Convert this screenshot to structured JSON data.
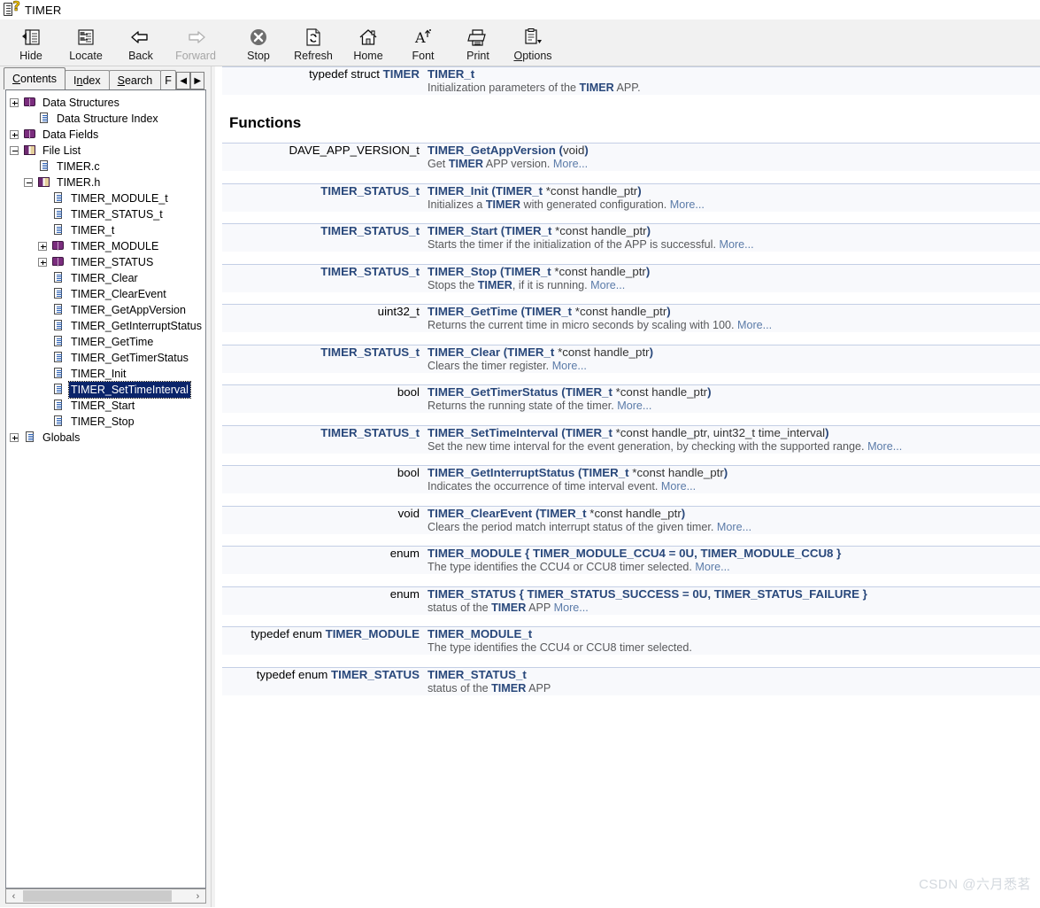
{
  "window": {
    "title": "TIMER",
    "icon": "help-book-question-icon"
  },
  "toolbar": {
    "buttons": [
      {
        "label": "Hide",
        "icon": "hide-pane-icon",
        "disabled": false,
        "accel": ""
      },
      {
        "label": "Locate",
        "icon": "locate-icon",
        "disabled": false,
        "accel": ""
      },
      {
        "label": "Back",
        "icon": "back-arrow-icon",
        "disabled": false,
        "accel": ""
      },
      {
        "label": "Forward",
        "icon": "forward-arrow-icon",
        "disabled": true,
        "accel": ""
      },
      {
        "label": "Stop",
        "icon": "stop-icon",
        "disabled": false,
        "accel": ""
      },
      {
        "label": "Refresh",
        "icon": "refresh-icon",
        "disabled": false,
        "accel": ""
      },
      {
        "label": "Home",
        "icon": "home-icon",
        "disabled": false,
        "accel": ""
      },
      {
        "label": "Font",
        "icon": "font-icon",
        "disabled": false,
        "accel": ""
      },
      {
        "label": "Print",
        "icon": "print-icon",
        "disabled": false,
        "accel": ""
      },
      {
        "label": "Options",
        "icon": "options-icon",
        "disabled": false,
        "accel": "O"
      }
    ]
  },
  "navpane": {
    "tabs": [
      {
        "label": "Contents",
        "active": true
      },
      {
        "label": "Index",
        "active": false
      },
      {
        "label": "Search",
        "active": false
      },
      {
        "label": "F",
        "active": false,
        "clipped": true
      }
    ],
    "spinners": {
      "left": "◀",
      "right": "▶"
    },
    "tree": [
      {
        "label": "Data Structures",
        "icon": "book-icon",
        "expander": "plus",
        "indent": 1,
        "selected": false
      },
      {
        "label": "Data Structure Index",
        "icon": "page-icon",
        "expander": "none",
        "indent": 2,
        "selected": false
      },
      {
        "label": "Data Fields",
        "icon": "book-icon",
        "expander": "plus",
        "indent": 1,
        "selected": false
      },
      {
        "label": "File List",
        "icon": "book-open-icon",
        "expander": "minus",
        "indent": 1,
        "selected": false
      },
      {
        "label": "TIMER.c",
        "icon": "page-icon",
        "expander": "none",
        "indent": 2,
        "selected": false
      },
      {
        "label": "TIMER.h",
        "icon": "book-open-icon",
        "expander": "minus",
        "indent": 2,
        "selected": false
      },
      {
        "label": "TIMER_MODULE_t",
        "icon": "page-icon",
        "expander": "none",
        "indent": 3,
        "selected": false
      },
      {
        "label": "TIMER_STATUS_t",
        "icon": "page-icon",
        "expander": "none",
        "indent": 3,
        "selected": false
      },
      {
        "label": "TIMER_t",
        "icon": "page-icon",
        "expander": "none",
        "indent": 3,
        "selected": false
      },
      {
        "label": "TIMER_MODULE",
        "icon": "book-icon",
        "expander": "plus",
        "indent": 3,
        "selected": false
      },
      {
        "label": "TIMER_STATUS",
        "icon": "book-icon",
        "expander": "plus",
        "indent": 3,
        "selected": false
      },
      {
        "label": "TIMER_Clear",
        "icon": "page-icon",
        "expander": "none",
        "indent": 3,
        "selected": false
      },
      {
        "label": "TIMER_ClearEvent",
        "icon": "page-icon",
        "expander": "none",
        "indent": 3,
        "selected": false
      },
      {
        "label": "TIMER_GetAppVersion",
        "icon": "page-icon",
        "expander": "none",
        "indent": 3,
        "selected": false
      },
      {
        "label": "TIMER_GetInterruptStatus",
        "icon": "page-icon",
        "expander": "none",
        "indent": 3,
        "selected": false
      },
      {
        "label": "TIMER_GetTime",
        "icon": "page-icon",
        "expander": "none",
        "indent": 3,
        "selected": false
      },
      {
        "label": "TIMER_GetTimerStatus",
        "icon": "page-icon",
        "expander": "none",
        "indent": 3,
        "selected": false
      },
      {
        "label": "TIMER_Init",
        "icon": "page-icon",
        "expander": "none",
        "indent": 3,
        "selected": false
      },
      {
        "label": "TIMER_SetTimeInterval",
        "icon": "page-icon",
        "expander": "none",
        "indent": 3,
        "selected": true
      },
      {
        "label": "TIMER_Start",
        "icon": "page-icon",
        "expander": "none",
        "indent": 3,
        "selected": false
      },
      {
        "label": "TIMER_Stop",
        "icon": "page-icon",
        "expander": "none",
        "indent": 3,
        "selected": false
      },
      {
        "label": "Globals",
        "icon": "page-icon",
        "expander": "plus",
        "indent": 1,
        "selected": false
      }
    ],
    "hscroll": {
      "left_arrow": "‹",
      "right_arrow": "›"
    }
  },
  "content": {
    "section_heading": "Functions",
    "rows": [
      {
        "left_plain": "typedef struct ",
        "left_link": "TIMER",
        "name": "TIMER_t",
        "args": "",
        "desc_html": "Initialization parameters of the <b>TIMER</b> APP.",
        "more": ""
      },
      {
        "left_plain": "DAVE_APP_VERSION_t",
        "left_link": "",
        "name": "TIMER_GetAppVersion",
        "args": " (void)",
        "desc_html": "Get <b>TIMER</b> APP version. ",
        "more": "More..."
      },
      {
        "left_plain": "",
        "left_link": "TIMER_STATUS_t",
        "name": "TIMER_Init",
        "args": " (TIMER_t *const handle_ptr)",
        "desc_html": "Initializes a <b>TIMER</b> with generated configuration. ",
        "more": "More..."
      },
      {
        "left_plain": "",
        "left_link": "TIMER_STATUS_t",
        "name": "TIMER_Start",
        "args": " (TIMER_t *const handle_ptr)",
        "desc_html": "Starts the timer if the initialization of the APP is successful. ",
        "more": "More..."
      },
      {
        "left_plain": "",
        "left_link": "TIMER_STATUS_t",
        "name": "TIMER_Stop",
        "args": " (TIMER_t *const handle_ptr)",
        "desc_html": "Stops the <b>TIMER</b>, if it is running. ",
        "more": "More..."
      },
      {
        "left_plain": "uint32_t",
        "left_link": "",
        "name": "TIMER_GetTime",
        "args": " (TIMER_t *const handle_ptr)",
        "desc_html": "Returns the current time in micro seconds by scaling with 100. ",
        "more": "More..."
      },
      {
        "left_plain": "",
        "left_link": "TIMER_STATUS_t",
        "name": "TIMER_Clear",
        "args": " (TIMER_t *const handle_ptr)",
        "desc_html": "Clears the timer register. ",
        "more": "More..."
      },
      {
        "left_plain": "bool",
        "left_link": "",
        "name": "TIMER_GetTimerStatus",
        "args": " (TIMER_t *const handle_ptr)",
        "desc_html": "Returns the running state of the timer. ",
        "more": "More..."
      },
      {
        "left_plain": "",
        "left_link": "TIMER_STATUS_t",
        "name": "TIMER_SetTimeInterval",
        "args": " (TIMER_t *const handle_ptr, uint32_t time_interval)",
        "desc_html": "Set the new time interval for the event generation, by checking with the supported range. ",
        "more": "More..."
      },
      {
        "left_plain": "bool",
        "left_link": "",
        "name": "TIMER_GetInterruptStatus",
        "args": " (TIMER_t *const handle_ptr)",
        "desc_html": "Indicates the occurrence of time interval event. ",
        "more": "More..."
      },
      {
        "left_plain": "void",
        "left_link": "",
        "name": "TIMER_ClearEvent",
        "args": " (TIMER_t *const handle_ptr)",
        "desc_html": "Clears the period match interrupt status of the given timer. ",
        "more": "More..."
      },
      {
        "left_plain": "enum",
        "left_link": "",
        "name": "TIMER_MODULE",
        "args": " { TIMER_MODULE_CCU4 = 0U, TIMER_MODULE_CCU8 }",
        "desc_html": "The type identifies the CCU4 or CCU8 timer selected. ",
        "more": "More...",
        "args_bold": true
      },
      {
        "left_plain": "enum",
        "left_link": "",
        "name": "TIMER_STATUS",
        "args": " { TIMER_STATUS_SUCCESS = 0U, TIMER_STATUS_FAILURE }",
        "desc_html": "status of the <b>TIMER</b> APP ",
        "more": "More...",
        "args_bold": true
      },
      {
        "left_plain": "typedef enum ",
        "left_link": "TIMER_MODULE",
        "name": "TIMER_MODULE_t",
        "args": "",
        "desc_html": "The type identifies the CCU4 or CCU8 timer selected.",
        "more": ""
      },
      {
        "left_plain": "typedef enum ",
        "left_link": "TIMER_STATUS",
        "name": "TIMER_STATUS_t",
        "args": "",
        "desc_html": "status of the <b>TIMER</b> APP",
        "more": ""
      }
    ],
    "watermark": "CSDN @六月悉茗"
  },
  "colors": {
    "link": "#29487b",
    "row_bg": "#f8f9fc",
    "row_border": "#c4cfe5",
    "selection": "#0A246A",
    "toolbar_bg": "#f1f1f1"
  }
}
